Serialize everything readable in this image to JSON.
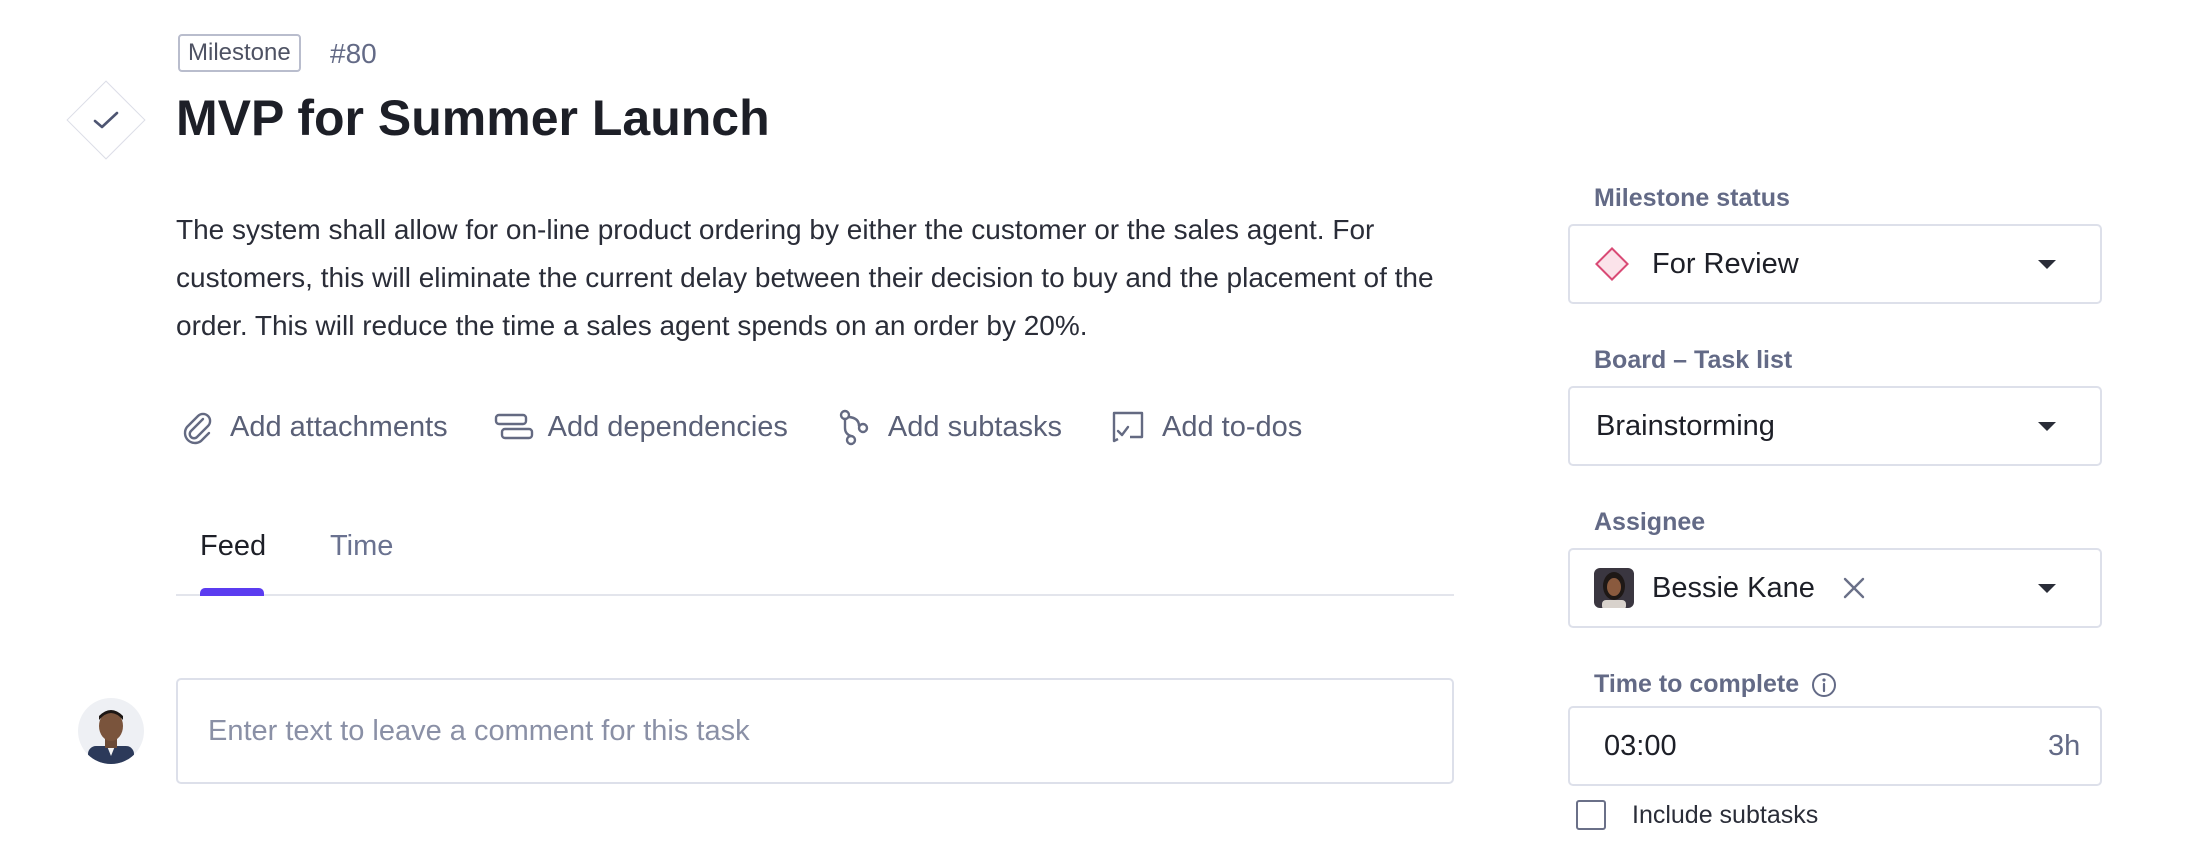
{
  "task": {
    "type_badge": "Milestone",
    "number": "#80",
    "title": "MVP for Summer Launch",
    "description": "The system shall allow for on-line product ordering by either the customer or the sales agent. For customers, this will eliminate the current delay between their decision to buy and the placement of the order. This will reduce the time a sales agent spends on an order by 20%."
  },
  "actions": [
    {
      "label": "Add attachments",
      "icon": "paperclip-icon"
    },
    {
      "label": "Add dependencies",
      "icon": "dependencies-icon"
    },
    {
      "label": "Add subtasks",
      "icon": "subtasks-icon"
    },
    {
      "label": "Add to-dos",
      "icon": "todo-icon"
    }
  ],
  "tabs": {
    "active": "Feed",
    "items": [
      "Feed",
      "Time"
    ]
  },
  "comment": {
    "placeholder": "Enter text to leave a comment for this task"
  },
  "sidebar": {
    "status": {
      "label": "Milestone status",
      "value": "For Review",
      "color": "#d94a75"
    },
    "board": {
      "label": "Board – Task list",
      "value": "Brainstorming"
    },
    "assignee": {
      "label": "Assignee",
      "value": "Bessie Kane"
    },
    "time": {
      "label": "Time to complete",
      "value": "03:00",
      "suffix": "3h"
    },
    "include_subtasks": {
      "label": "Include subtasks",
      "checked": false
    }
  },
  "colors": {
    "accent": "#5b3cf0",
    "muted_text": "#636a86",
    "border": "#dde0ea"
  }
}
